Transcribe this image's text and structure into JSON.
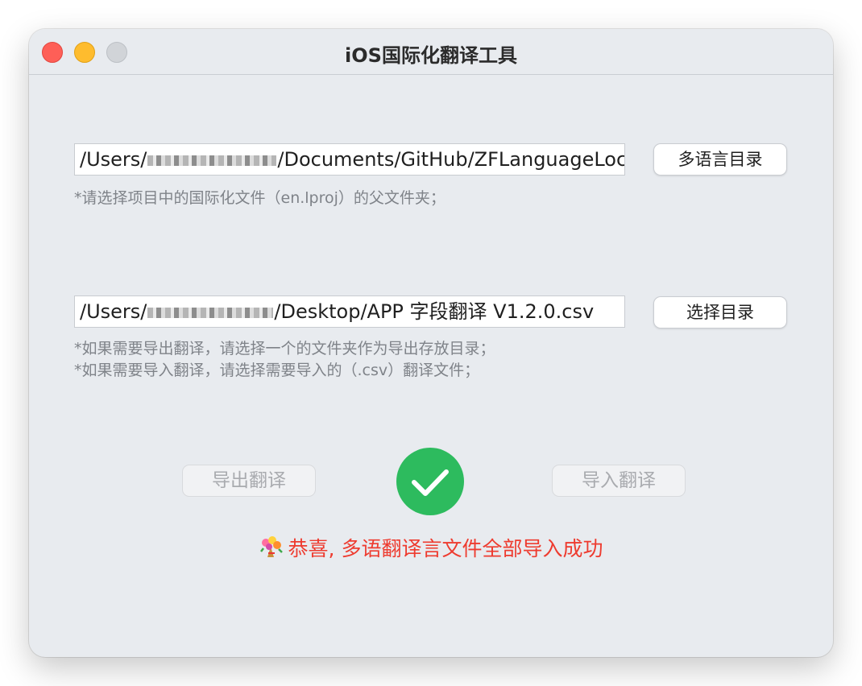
{
  "window": {
    "title": "iOS国际化翻译工具"
  },
  "localization_dir": {
    "path_prefix": "/Users/",
    "path_suffix": "/Documents/GitHub/ZFLanguageLoc",
    "button_label": "多语言目录",
    "hint": "*请选择项目中的国际化文件（en.lproj）的父文件夹；"
  },
  "export_dir": {
    "path_prefix": "/Users/",
    "path_suffix": "/Desktop/APP 字段翻译 V1.2.0.csv",
    "button_label": "选择目录",
    "hint_line1": "*如果需要导出翻译，请选择一个的文件夹作为导出存放目录；",
    "hint_line2": "*如果需要导入翻译，请选择需要导入的（.csv）翻译文件；"
  },
  "actions": {
    "export_label": "导出翻译",
    "import_label": "导入翻译"
  },
  "status": {
    "icon": "checkmark-circle-icon",
    "message": "恭喜, 多语翻译言文件全部导入成功",
    "color": "#ee3b2f"
  },
  "colors": {
    "success": "#2dbb5e",
    "close": "#fe5f57",
    "minimize": "#febc2e",
    "zoom": "#d1d4d8"
  }
}
